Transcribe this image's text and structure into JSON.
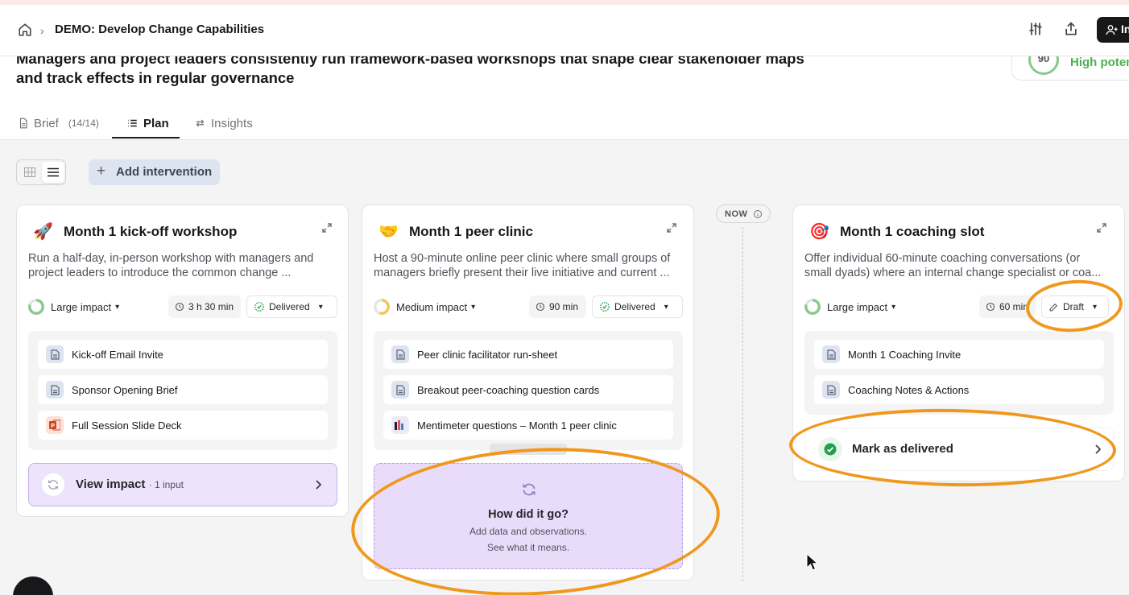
{
  "header": {
    "breadcrumb_title": "DEMO: Develop Change Capabilities",
    "invite_label": "In"
  },
  "goal": {
    "text": "Managers and project leaders consistently run framework-based workshops that shape clear stakeholder maps and track effects in regular governance",
    "score": "90",
    "potential_label": "High poten"
  },
  "tabs": [
    {
      "label": "Brief",
      "count": "(14/14)"
    },
    {
      "label": "Plan"
    },
    {
      "label": "Insights"
    }
  ],
  "toolbar": {
    "add_label": "Add intervention"
  },
  "timeline": {
    "now_label": "NOW"
  },
  "cards": [
    {
      "emoji": "🚀",
      "title": "Month 1 kick-off workshop",
      "desc_line1": "Run a half-day, in-person workshop with managers and",
      "desc_line2": "project leaders to introduce the common change ...",
      "impact": "Large impact",
      "duration": "3 h 30 min",
      "status": "Delivered",
      "assets": [
        "Kick-off Email Invite",
        "Sponsor Opening Brief",
        "Full Session Slide Deck"
      ],
      "footer_label": "View impact",
      "footer_sub": "· 1 input"
    },
    {
      "emoji": "🤝",
      "title": "Month 1 peer clinic",
      "desc_line1": "Host a 90-minute online peer clinic where small groups of",
      "desc_line2": "managers briefly present their live initiative and current ...",
      "impact": "Medium impact",
      "duration": "90 min",
      "status": "Delivered",
      "assets": [
        "Peer clinic facilitator run-sheet",
        "Breakout peer-coaching question cards",
        "Mentimeter questions – Month 1 peer clinic"
      ],
      "how_title": "How did it go?",
      "how_sub1": "Add data and observations.",
      "how_sub2": "See what it means."
    },
    {
      "emoji": "🎯",
      "title": "Month 1 coaching slot",
      "desc_line1": "Offer individual 60-minute coaching conversations (or",
      "desc_line2": "small dyads) where an internal change specialist or coa...",
      "impact": "Large impact",
      "duration": "60 min",
      "status": "Draft",
      "assets": [
        "Month 1 Coaching Invite",
        "Coaching Notes & Actions"
      ],
      "footer_label": "Mark as delivered"
    }
  ],
  "colors": {
    "accent_purple": "#ede4fb",
    "annotation_orange": "#f0981e",
    "success_green": "#22a04b"
  }
}
